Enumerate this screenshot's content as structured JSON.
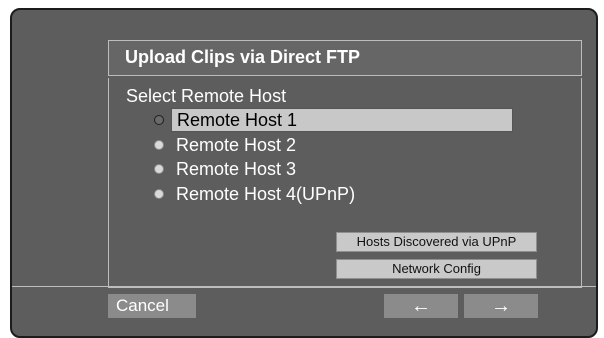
{
  "dialog": {
    "title": "Upload Clips via Direct FTP",
    "heading": "Select Remote Host"
  },
  "hosts": [
    {
      "label": "Remote Host 1",
      "selected": true
    },
    {
      "label": "Remote Host 2",
      "selected": false
    },
    {
      "label": "Remote Host 3",
      "selected": false
    },
    {
      "label": "Remote Host 4(UPnP)",
      "selected": false
    }
  ],
  "buttons": {
    "discover": "Hosts Discovered via UPnP",
    "network": "Network Config",
    "cancel": "Cancel",
    "prev": "←",
    "next": "→"
  },
  "icons": {
    "prev": "left-arrow-icon",
    "next": "right-arrow-icon",
    "radio": "radio-icon"
  },
  "colors": {
    "screen_bg": "#5d5d5d",
    "selected_bg": "#c8c8c8",
    "button_bg": "#8b8b8b"
  }
}
